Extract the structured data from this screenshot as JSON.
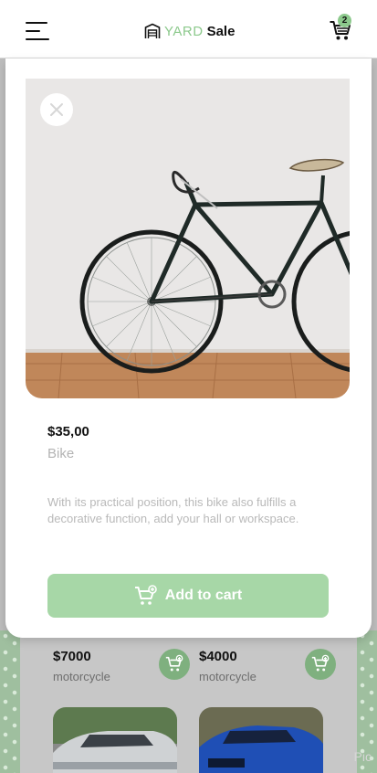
{
  "header": {
    "logo_yard": "YARD",
    "logo_sale": "Sale",
    "cart_count": "2"
  },
  "modal": {
    "price": "$35,00",
    "name": "Bike",
    "description": "With its practical position, this bike also fulfills a decorative function, add your hall or workspace.",
    "add_label": "Add to cart"
  },
  "listing": [
    {
      "price": "$7000",
      "name": "motorcycle"
    },
    {
      "price": "$4000",
      "name": "motorcycle"
    }
  ],
  "watermark": "Pic",
  "colors": {
    "accent": "#8cc98c",
    "button": "#a7d7a7",
    "text_muted": "#b3b3b3"
  }
}
